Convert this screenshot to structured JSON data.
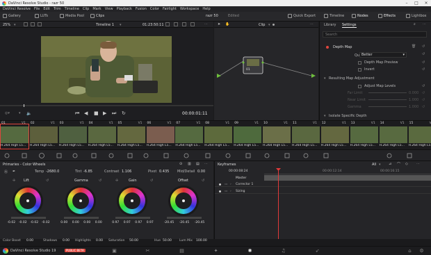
{
  "window": {
    "title": "DaVinci Resolve Studio - razr 50"
  },
  "menu": [
    "DaVinci Resolve",
    "File",
    "Edit",
    "Trim",
    "Timeline",
    "Clip",
    "Mark",
    "View",
    "Playback",
    "Fusion",
    "Color",
    "Fairlight",
    "Workspace",
    "Help"
  ],
  "toolbar": {
    "gallery": "Gallery",
    "luts": "LUTs",
    "media_pool": "Media Pool",
    "clips": "Clips",
    "project": "razr 50",
    "status": "Edited",
    "quick_export": "Quick Export",
    "timeline": "Timeline",
    "nodes": "Nodes",
    "effects": "Effects",
    "lightbox": "Lightbox"
  },
  "viewer": {
    "zoom": "25%",
    "timeline_name": "Timeline 1",
    "timecode": "01:23:50:11",
    "playhead_tc": "00:00:01:11"
  },
  "nodegraph": {
    "mode": "Clip",
    "node_label": "01"
  },
  "inspector": {
    "tabs": [
      "Library",
      "Settings"
    ],
    "search_placeholder": "Search",
    "depth_map": "Depth Map",
    "quality_label": "Quality",
    "quality_value": "Better",
    "depth_map_preview": "Depth Map Preview",
    "invert": "Invert",
    "resulting_adj": "Resulting Map Adjustment",
    "adjust_levels": "Adjust Map Levels",
    "sub1": "Far Limit",
    "sub1_val": "0.000",
    "sub2": "Near Limit",
    "sub2_val": "1.000",
    "sub3": "Gamma",
    "sub3_val": "1.000",
    "isolate": "Isolate Specific Depth"
  },
  "clips": [
    {
      "num": "01",
      "v": "V1",
      "label": "H.264 High L5..."
    },
    {
      "num": "02",
      "v": "V1",
      "label": "H.264 High L5..."
    },
    {
      "num": "03",
      "v": "V1",
      "label": "H.264 High L5..."
    },
    {
      "num": "04",
      "v": "V1",
      "label": "H.264 High L5..."
    },
    {
      "num": "05",
      "v": "V1",
      "label": "H.264 High L5..."
    },
    {
      "num": "06",
      "v": "V1",
      "label": "H.264 High L5..."
    },
    {
      "num": "07",
      "v": "V1",
      "label": "H.264 High L5..."
    },
    {
      "num": "08",
      "v": "V1",
      "label": "H.264 High L5..."
    },
    {
      "num": "09",
      "v": "V1",
      "label": "H.264 High L5..."
    },
    {
      "num": "10",
      "v": "V1",
      "label": "H.264 High L5..."
    },
    {
      "num": "11",
      "v": "V1",
      "label": "H.264 High L5..."
    },
    {
      "num": "12",
      "v": "V1",
      "label": "H.264 High L5..."
    },
    {
      "num": "13",
      "v": "V1",
      "label": "H.264 High L5..."
    },
    {
      "num": "14",
      "v": "V1",
      "label": "H.264 High L5..."
    },
    {
      "num": "15",
      "v": "V1",
      "label": "H.264 High L5..."
    }
  ],
  "primaries": {
    "title": "Primaries - Color Wheels",
    "temp_label": "Temp",
    "temp": "-2680.0",
    "tint_label": "Tint",
    "tint": "-6.85",
    "contrast_label": "Contrast",
    "contrast": "1.106",
    "pivot_label": "Pivot",
    "pivot": "0.435",
    "middetail_label": "Mid/Detail",
    "middetail": "0.00",
    "wheels": [
      {
        "name": "Lift",
        "vals": [
          "-0.02",
          "-0.02",
          "-0.02",
          "-0.02"
        ]
      },
      {
        "name": "Gamma",
        "vals": [
          "0.00",
          "0.00",
          "0.00",
          "0.00"
        ]
      },
      {
        "name": "Gain",
        "vals": [
          "0.97",
          "0.97",
          "0.97",
          "0.97"
        ]
      },
      {
        "name": "Offset",
        "vals": [
          "-20.45",
          "-20.45",
          "-20.45"
        ]
      }
    ],
    "color_boost_label": "Color Boost",
    "color_boost": "0.00",
    "shadows_label": "Shadows",
    "shadows": "0.00",
    "highlights_label": "Highlights",
    "highlights": "0.00",
    "saturation_label": "Saturation",
    "saturation": "50.00",
    "hue_label": "Hue",
    "hue": "50.00",
    "lummix_label": "Lum Mix",
    "lummix": "100.00"
  },
  "keyframes": {
    "title": "Keyframes",
    "filter": "All",
    "tc": "00:00:08:24",
    "tc2": "00:00:12:14",
    "tc3": "00:00:16:15",
    "tracks": [
      "Master",
      "Corrector 1",
      "Sizing"
    ]
  },
  "bottom": {
    "app": "DaVinci Resolve Studio 19",
    "badge": "PUBLIC BETA"
  },
  "colors": {
    "accent_red": "#e0463d",
    "node_green": "#6fbf3d",
    "playhead": "#e23a3a"
  }
}
